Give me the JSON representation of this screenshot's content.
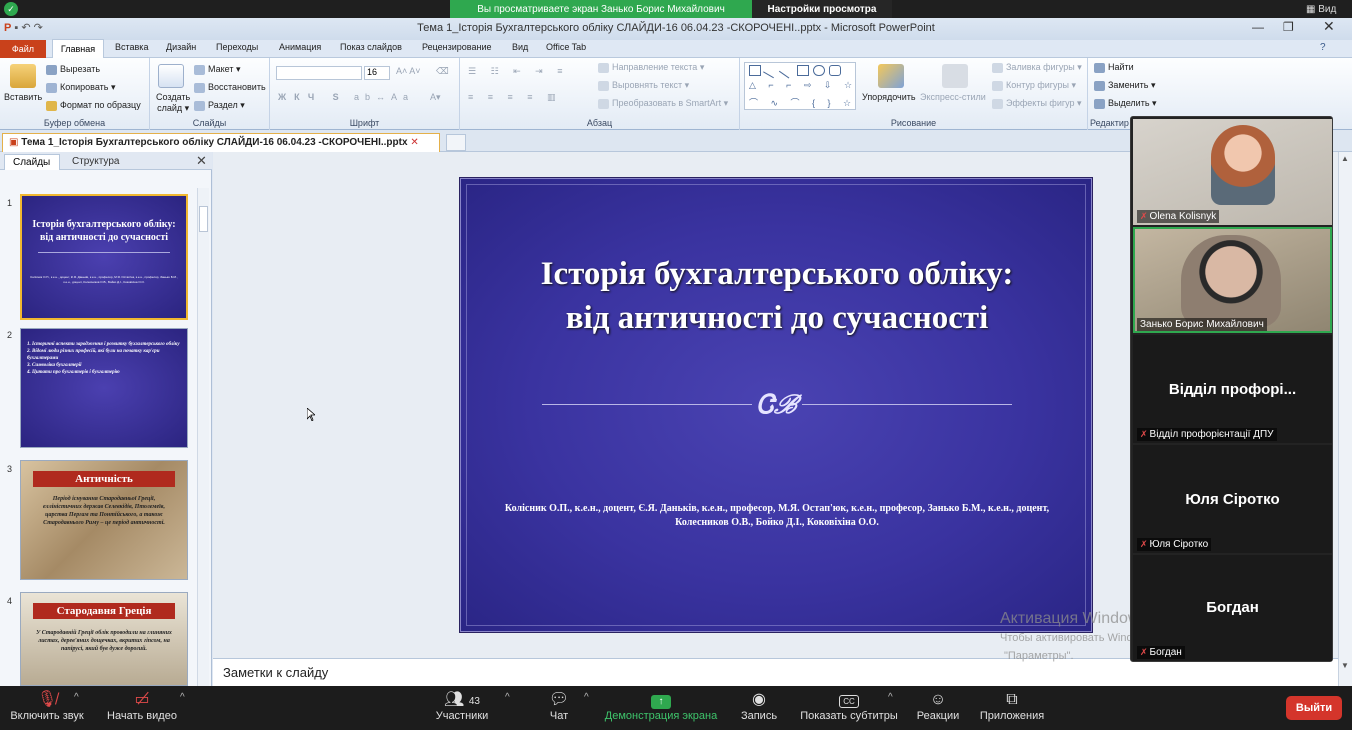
{
  "zoom_top": {
    "banner": "Вы просматриваете экран Занько Борис Михайлович",
    "view_options": "Настройки просмотра",
    "view_label": "Вид"
  },
  "ppt_window": {
    "title": "Тема 1_Історія Бухгалтерського обліку СЛАЙДИ-16 06.04.23 -СКОРОЧЕНІ..pptx - Microsoft PowerPoint"
  },
  "ribbon_tabs": [
    "Файл",
    "Главная",
    "Вставка",
    "Дизайн",
    "Переходы",
    "Анимация",
    "Показ слайдов",
    "Рецензирование",
    "Вид",
    "Office Tab"
  ],
  "ribbon": {
    "clipboard": {
      "paste": "Вставить",
      "cut": "Вырезать",
      "copy": "Копировать",
      "format": "Формат по образцу",
      "label": "Буфер обмена"
    },
    "slides": {
      "new_slide_1": "Создать",
      "new_slide_2": "слайд",
      "layout": "Макет",
      "reset": "Восстановить",
      "section": "Раздел",
      "label": "Слайды"
    },
    "font": {
      "size": "16",
      "label": "Шрифт"
    },
    "paragraph": {
      "text_direction": "Направление текста",
      "align_text": "Выровнять текст",
      "smartart": "Преобразовать в SmartArt",
      "label": "Абзац"
    },
    "drawing": {
      "arrange": "Упорядочить",
      "quick_styles": "Экспресс-стили",
      "fill": "Заливка фигуры",
      "outline": "Контур фигуры",
      "effects": "Эффекты фигур",
      "label": "Рисование"
    },
    "editing": {
      "find": "Найти",
      "replace": "Заменить",
      "select": "Выделить",
      "label": "Редактир"
    }
  },
  "doc_tab": "Тема 1_Історія Бухгалтерського обліку СЛАЙДИ-16 06.04.23 -СКОРОЧЕНІ..pptx",
  "left_pane": {
    "tab_slides": "Слайды",
    "tab_outline": "Структура",
    "thumbs": [
      {
        "num": "1",
        "title": "Історія бухгалтерського обліку: від античності до сучасності",
        "sub": "Колісник О.П., к.е.н., доцент, Є.Я. Даньків, к.е.н., професор, М.Я. Остап'юк, к.е.н., професор, Занько Б.М., к.е.н., доцент, Колесников О.В., Бойко Д.І., Коковіхіна О.О."
      },
      {
        "num": "2",
        "lines": [
          "1. Історичні аспекти зародження і розвитку бухгалтерського обліку",
          "2. Відомі люди різних професій, які були на початку кар'єри бухгалтерами",
          "3. Символіка бухгалтерії",
          "4. Цитати про бухгалтерів і бухгалтерію"
        ]
      },
      {
        "num": "3",
        "header": "Античність",
        "body": "Період існування Стародавньої Греції, еллiністичних держав Селевкідів, Птолемеїв, царства Пергам та Понтійського, а також Стародавнього Риму – це період античності."
      },
      {
        "num": "4",
        "header": "Стародавня Греція",
        "body": "У Стародавній Греції облік проводили на глиняних листах, дерев'яних дощечках, вкритих гіпсом, на папірусі, який був дуже дорогий."
      }
    ]
  },
  "slide": {
    "title_line1": "Історія бухгалтерського обліку:",
    "title_line2": "від античності до сучасності",
    "ornament": "Ꮳℬ",
    "authors_line1": "Колісник О.П., к.е.н., доцент, Є.Я. Даньків, к.е.н., професор, М.Я. Остап'юк, к.е.н., професор, Занько Б.М., к.е.н., доцент,",
    "authors_line2": "Колесников О.В., Бойко Д.І., Коковіхіна О.О."
  },
  "notes_placeholder": "Заметки к слайду",
  "activation": {
    "line1": "Активация Windows",
    "line2": "Чтобы активировать Windows, перейдите в раздел",
    "line3": "\"Параметры\"."
  },
  "participants": [
    {
      "name": "Olena Kolisnyk",
      "video": true
    },
    {
      "name": "Занько Борис Михайлович",
      "video": true
    },
    {
      "name": "Відділ профорієнтації ДПУ",
      "big": "Відділ профорі..."
    },
    {
      "name": "Юля Сіротко",
      "big": "Юля Сіротко"
    },
    {
      "name": "Богдан",
      "big": "Богдан"
    }
  ],
  "zoom_toolbar": {
    "unmute": "Включить звук",
    "start_video": "Начать видео",
    "participants": "Участники",
    "participants_count": "43",
    "chat": "Чат",
    "share": "Демонстрация экрана",
    "record": "Запись",
    "captions": "Показать субтитры",
    "reactions": "Реакции",
    "apps": "Приложения",
    "leave": "Выйти"
  },
  "colors": {
    "share_green": "#2fa84f",
    "slide_bg": "#3a33a0",
    "leave_red": "#d4352b",
    "file_tab": "#c9411b"
  }
}
